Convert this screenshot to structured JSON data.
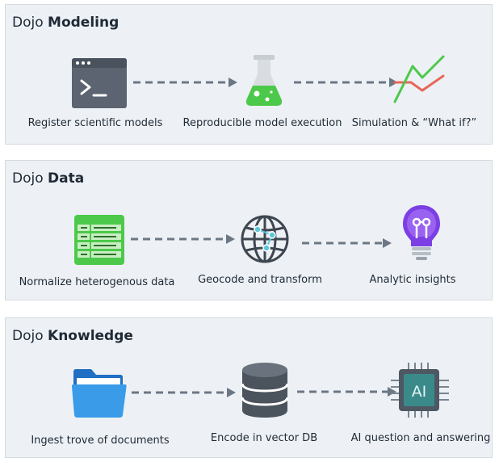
{
  "panels": [
    {
      "title_prefix": "Dojo",
      "title_bold": "Modeling",
      "steps": [
        {
          "label": "Register scientific models",
          "icon": "terminal-window-icon"
        },
        {
          "label": "Reproducible model execution",
          "icon": "flask-icon"
        },
        {
          "label": "Simulation & “What if?”",
          "icon": "line-chart-icon"
        }
      ]
    },
    {
      "title_prefix": "Dojo",
      "title_bold": "Data",
      "steps": [
        {
          "label": "Normalize heterogenous data",
          "icon": "spreadsheet-icon"
        },
        {
          "label": "Geocode and transform",
          "icon": "globe-network-icon"
        },
        {
          "label": "Analytic insights",
          "icon": "lightbulb-icon"
        }
      ]
    },
    {
      "title_prefix": "Dojo",
      "title_bold": "Knowledge",
      "steps": [
        {
          "label": "Ingest trove of documents",
          "icon": "folder-icon"
        },
        {
          "label": "Encode in vector DB",
          "icon": "database-icon"
        },
        {
          "label": "AI question and answering",
          "icon": "ai-chip-icon"
        }
      ]
    }
  ],
  "colors": {
    "panel_bg": "#edf1f5",
    "arrow": "#6b7785",
    "green": "#4cc94a",
    "purple": "#7b3fe4",
    "folder_blue": "#3a9be8",
    "chip_teal": "#3a8a8a"
  }
}
